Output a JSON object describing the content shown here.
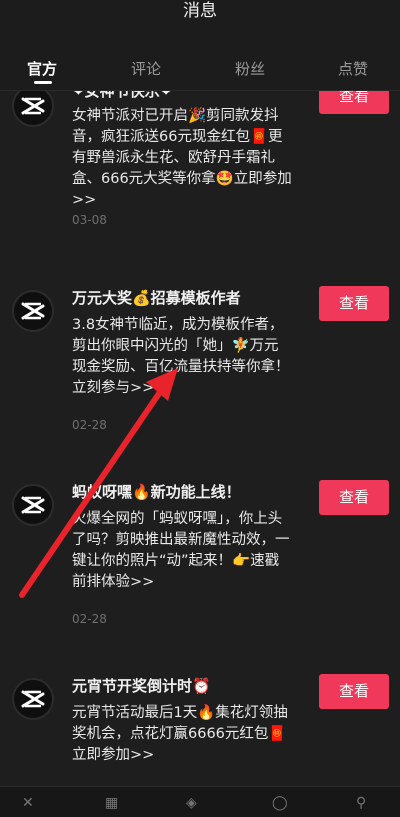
{
  "header": {
    "title": "消息"
  },
  "tabs": [
    {
      "label": "官方",
      "active": true
    },
    {
      "label": "评论",
      "active": false
    },
    {
      "label": "粉丝",
      "active": false
    },
    {
      "label": "点赞",
      "active": false
    }
  ],
  "messages": [
    {
      "title": "❤女神节快乐❤",
      "body": "女神节派对已开启🎉剪同款发抖音，疯狂派送66元现金红包🧧更有野兽派永生花、欧舒丹手霜礼盒、666元大奖等你拿🤩立即参加>>",
      "date": "03-08",
      "action": "查看"
    },
    {
      "title": "万元大奖💰招募模板作者",
      "body": "3.8女神节临近，成为模板作者，剪出你眼中闪光的「她」🧚万元现金奖励、百亿流量扶持等你拿！立刻参与>>",
      "date": "02-28",
      "action": "查看"
    },
    {
      "title": "蚂蚁呀嘿🔥新功能上线！",
      "body": "火爆全网的「蚂蚁呀嘿」，你上头了吗？剪映推出最新魔性动效，一键让你的照片“动”起来！👉速戳前排体验>>",
      "date": "02-28",
      "action": "查看"
    },
    {
      "title": "元宵节开奖倒计时⏰",
      "body": "元宵节活动最后1天🔥集花灯领抽奖机会，点花灯赢6666元红包🧧立即参加>>",
      "date": "",
      "action": "查看"
    }
  ],
  "colors": {
    "accent": "#f0385a",
    "arrow": "#e8232b",
    "background": "#1e1e1e"
  },
  "icons": [
    "capcut-logo-icon",
    "close-icon",
    "film-icon",
    "layers-icon",
    "search-icon"
  ]
}
